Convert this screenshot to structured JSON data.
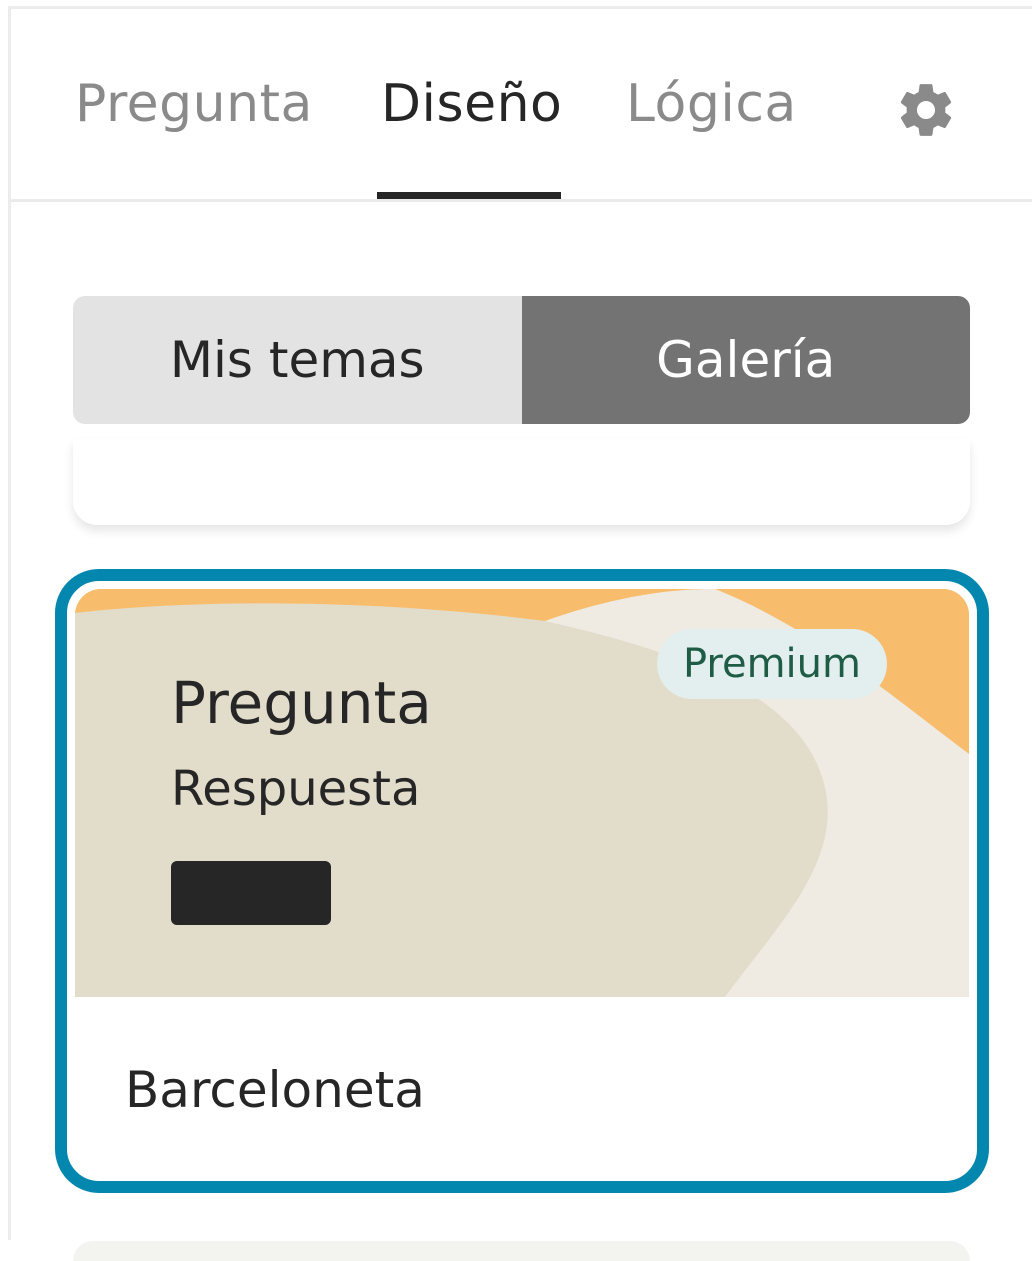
{
  "tabs": [
    {
      "label": "Pregunta",
      "active": false
    },
    {
      "label": "Diseño",
      "active": true
    },
    {
      "label": "Lógica",
      "active": false
    }
  ],
  "settings_icon": "gear-icon",
  "theme_switch": {
    "options": [
      "Mis temas",
      "Galería"
    ],
    "selected": "Galería"
  },
  "theme_card": {
    "preview_question": "Pregunta",
    "preview_answer": "Respuesta",
    "badge": "Premium",
    "name": "Barceloneta",
    "selected": true
  },
  "colors": {
    "selection_border": "#0487ae",
    "preview_background": "#e2dccb",
    "preview_accent": "#f8bd6c",
    "preview_light": "#efebe3",
    "badge_bg": "#e3efee",
    "badge_text": "#1f5c46",
    "segment_active": "#737373",
    "segment_inactive": "#e3e3e3"
  }
}
